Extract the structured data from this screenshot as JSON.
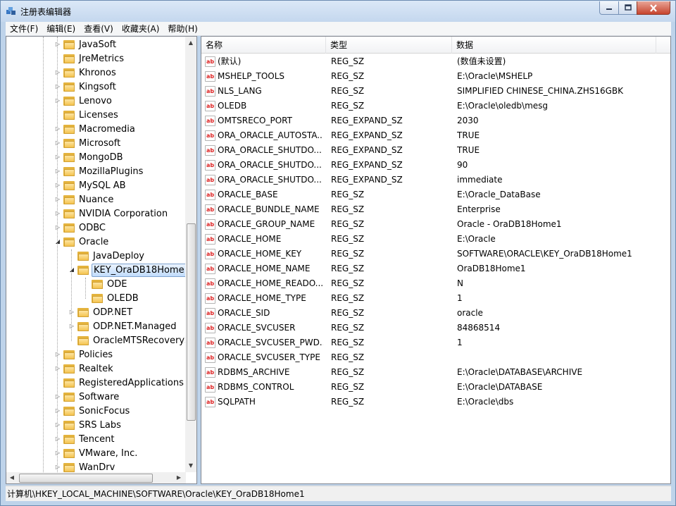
{
  "window": {
    "title": "注册表编辑器",
    "icon": "registry-cube-icon"
  },
  "menu": [
    {
      "label": "文件(F)"
    },
    {
      "label": "编辑(E)"
    },
    {
      "label": "查看(V)"
    },
    {
      "label": "收藏夹(A)"
    },
    {
      "label": "帮助(H)"
    }
  ],
  "tree": {
    "items": [
      {
        "label": "JavaSoft",
        "level": 0,
        "expander": "collapsed"
      },
      {
        "label": "JreMetrics",
        "level": 0,
        "expander": "none"
      },
      {
        "label": "Khronos",
        "level": 0,
        "expander": "collapsed"
      },
      {
        "label": "Kingsoft",
        "level": 0,
        "expander": "collapsed"
      },
      {
        "label": "Lenovo",
        "level": 0,
        "expander": "collapsed"
      },
      {
        "label": "Licenses",
        "level": 0,
        "expander": "none"
      },
      {
        "label": "Macromedia",
        "level": 0,
        "expander": "collapsed"
      },
      {
        "label": "Microsoft",
        "level": 0,
        "expander": "collapsed"
      },
      {
        "label": "MongoDB",
        "level": 0,
        "expander": "collapsed"
      },
      {
        "label": "MozillaPlugins",
        "level": 0,
        "expander": "collapsed"
      },
      {
        "label": "MySQL AB",
        "level": 0,
        "expander": "collapsed"
      },
      {
        "label": "Nuance",
        "level": 0,
        "expander": "collapsed"
      },
      {
        "label": "NVIDIA Corporation",
        "level": 0,
        "expander": "collapsed"
      },
      {
        "label": "ODBC",
        "level": 0,
        "expander": "collapsed"
      },
      {
        "label": "Oracle",
        "level": 0,
        "expander": "expanded"
      },
      {
        "label": "JavaDeploy",
        "level": 1,
        "expander": "none"
      },
      {
        "label": "KEY_OraDB18Home1",
        "level": 1,
        "expander": "expanded",
        "selected": true
      },
      {
        "label": "ODE",
        "level": 2,
        "expander": "none"
      },
      {
        "label": "OLEDB",
        "level": 2,
        "expander": "none"
      },
      {
        "label": "ODP.NET",
        "level": 1,
        "expander": "collapsed"
      },
      {
        "label": "ODP.NET.Managed",
        "level": 1,
        "expander": "collapsed"
      },
      {
        "label": "OracleMTSRecoverySe",
        "level": 1,
        "expander": "none"
      },
      {
        "label": "Policies",
        "level": 0,
        "expander": "collapsed"
      },
      {
        "label": "Realtek",
        "level": 0,
        "expander": "collapsed"
      },
      {
        "label": "RegisteredApplications",
        "level": 0,
        "expander": "none"
      },
      {
        "label": "Software",
        "level": 0,
        "expander": "collapsed"
      },
      {
        "label": "SonicFocus",
        "level": 0,
        "expander": "collapsed"
      },
      {
        "label": "SRS Labs",
        "level": 0,
        "expander": "collapsed"
      },
      {
        "label": "Tencent",
        "level": 0,
        "expander": "collapsed"
      },
      {
        "label": "VMware, Inc.",
        "level": 0,
        "expander": "collapsed"
      },
      {
        "label": "WanDrv",
        "level": 0,
        "expander": "collapsed"
      }
    ]
  },
  "list": {
    "columns": [
      "名称",
      "类型",
      "数据"
    ],
    "rows": [
      {
        "name": "(默认)",
        "type": "REG_SZ",
        "data": "(数值未设置)"
      },
      {
        "name": "MSHELP_TOOLS",
        "type": "REG_SZ",
        "data": "E:\\Oracle\\MSHELP"
      },
      {
        "name": "NLS_LANG",
        "type": "REG_SZ",
        "data": "SIMPLIFIED CHINESE_CHINA.ZHS16GBK"
      },
      {
        "name": "OLEDB",
        "type": "REG_SZ",
        "data": "E:\\Oracle\\oledb\\mesg"
      },
      {
        "name": "OMTSRECO_PORT",
        "type": "REG_EXPAND_SZ",
        "data": "2030"
      },
      {
        "name": "ORA_ORACLE_AUTOSTA...",
        "type": "REG_EXPAND_SZ",
        "data": "TRUE"
      },
      {
        "name": "ORA_ORACLE_SHUTDO...",
        "type": "REG_EXPAND_SZ",
        "data": "TRUE"
      },
      {
        "name": "ORA_ORACLE_SHUTDO...",
        "type": "REG_EXPAND_SZ",
        "data": "90"
      },
      {
        "name": "ORA_ORACLE_SHUTDO...",
        "type": "REG_EXPAND_SZ",
        "data": "immediate"
      },
      {
        "name": "ORACLE_BASE",
        "type": "REG_SZ",
        "data": "E:\\Oracle_DataBase"
      },
      {
        "name": "ORACLE_BUNDLE_NAME",
        "type": "REG_SZ",
        "data": "Enterprise"
      },
      {
        "name": "ORACLE_GROUP_NAME",
        "type": "REG_SZ",
        "data": "Oracle - OraDB18Home1"
      },
      {
        "name": "ORACLE_HOME",
        "type": "REG_SZ",
        "data": "E:\\Oracle"
      },
      {
        "name": "ORACLE_HOME_KEY",
        "type": "REG_SZ",
        "data": "SOFTWARE\\ORACLE\\KEY_OraDB18Home1"
      },
      {
        "name": "ORACLE_HOME_NAME",
        "type": "REG_SZ",
        "data": "OraDB18Home1"
      },
      {
        "name": "ORACLE_HOME_READO...",
        "type": "REG_SZ",
        "data": "N"
      },
      {
        "name": "ORACLE_HOME_TYPE",
        "type": "REG_SZ",
        "data": "1"
      },
      {
        "name": "ORACLE_SID",
        "type": "REG_SZ",
        "data": "oracle"
      },
      {
        "name": "ORACLE_SVCUSER",
        "type": "REG_SZ",
        "data": "84868514"
      },
      {
        "name": "ORACLE_SVCUSER_PWD...",
        "type": "REG_SZ",
        "data": "1"
      },
      {
        "name": "ORACLE_SVCUSER_TYPE",
        "type": "REG_SZ",
        "data": ""
      },
      {
        "name": "RDBMS_ARCHIVE",
        "type": "REG_SZ",
        "data": "E:\\Oracle\\DATABASE\\ARCHIVE"
      },
      {
        "name": "RDBMS_CONTROL",
        "type": "REG_SZ",
        "data": "E:\\Oracle\\DATABASE"
      },
      {
        "name": "SQLPATH",
        "type": "REG_SZ",
        "data": "E:\\Oracle\\dbs"
      }
    ],
    "value_icon": "string-value-icon",
    "value_icon_text": "ab"
  },
  "statusbar": {
    "path": "计算机\\HKEY_LOCAL_MACHINE\\SOFTWARE\\Oracle\\KEY_OraDB18Home1"
  }
}
